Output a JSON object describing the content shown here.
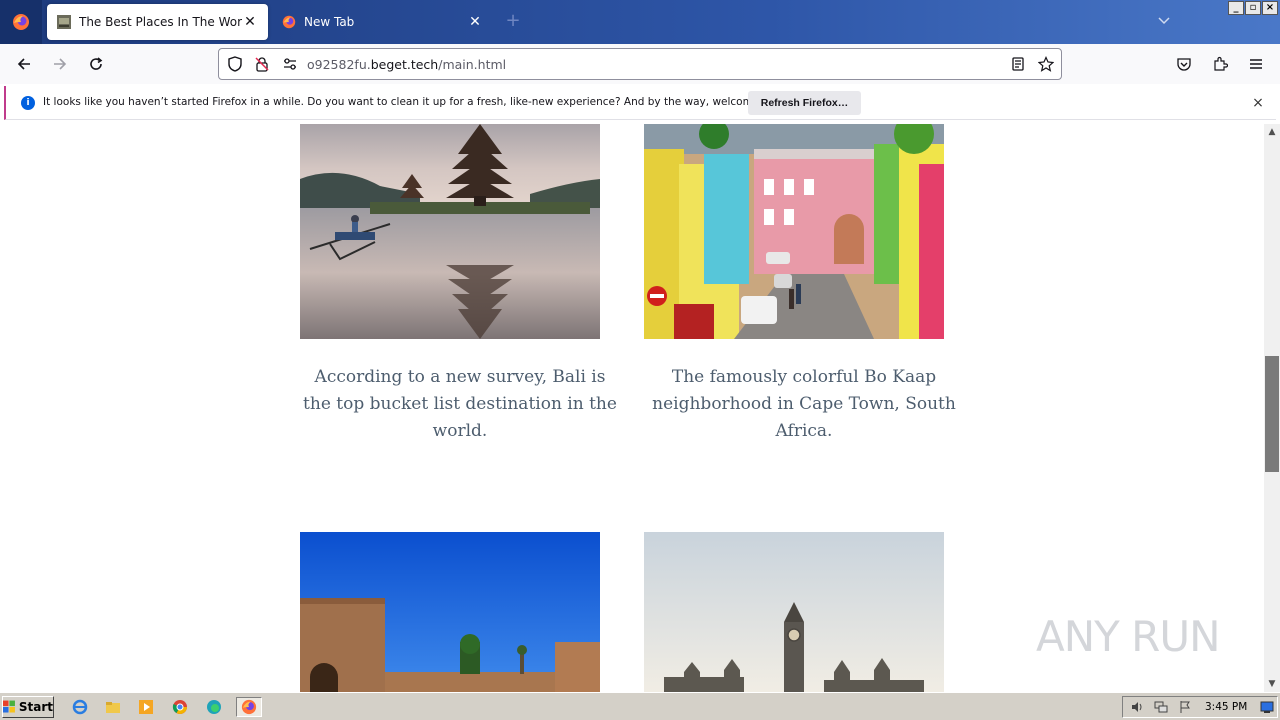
{
  "browser": {
    "tabs": [
      {
        "title": "The Best Places In The World",
        "active": true,
        "icon": "site-favicon"
      },
      {
        "title": "New Tab",
        "active": false,
        "icon": "firefox-icon"
      }
    ],
    "new_tab_label": "+",
    "url": {
      "prefix": "o92582fu.",
      "host": "beget.tech",
      "path": "/main.html"
    },
    "window_buttons": [
      "_",
      "▫",
      "×"
    ]
  },
  "notification": {
    "message": "It looks like you haven’t started Firefox in a while. Do you want to clean it up for a fresh, like-new experience? And by the way, welcome back!",
    "button_label": "Refresh Firefox…",
    "icon": "info-icon",
    "close": "×"
  },
  "page": {
    "items": [
      {
        "image": "bali-temple-photo",
        "caption": "According to a new survey, Bali is the top bucket list destination in the world."
      },
      {
        "image": "bo-kaap-photo",
        "caption": "The famously colorful Bo Kaap neighborhood in Cape Town, South Africa."
      },
      {
        "image": "marrakech-palace-photo",
        "caption": ""
      },
      {
        "image": "london-big-ben-photo",
        "caption": ""
      }
    ],
    "watermark": "ANY RUN"
  },
  "taskbar": {
    "start_label": "Start",
    "apps": [
      "ie-icon",
      "explorer-icon",
      "media-player-icon",
      "chrome-icon",
      "edge-icon",
      "firefox-icon"
    ],
    "clock": "3:45 PM"
  },
  "colors": {
    "tabbar": "#1f3a78",
    "caption_text": "#4d5d6e",
    "notification_accent": "#c03b8c",
    "link_blue": "#0060df"
  }
}
